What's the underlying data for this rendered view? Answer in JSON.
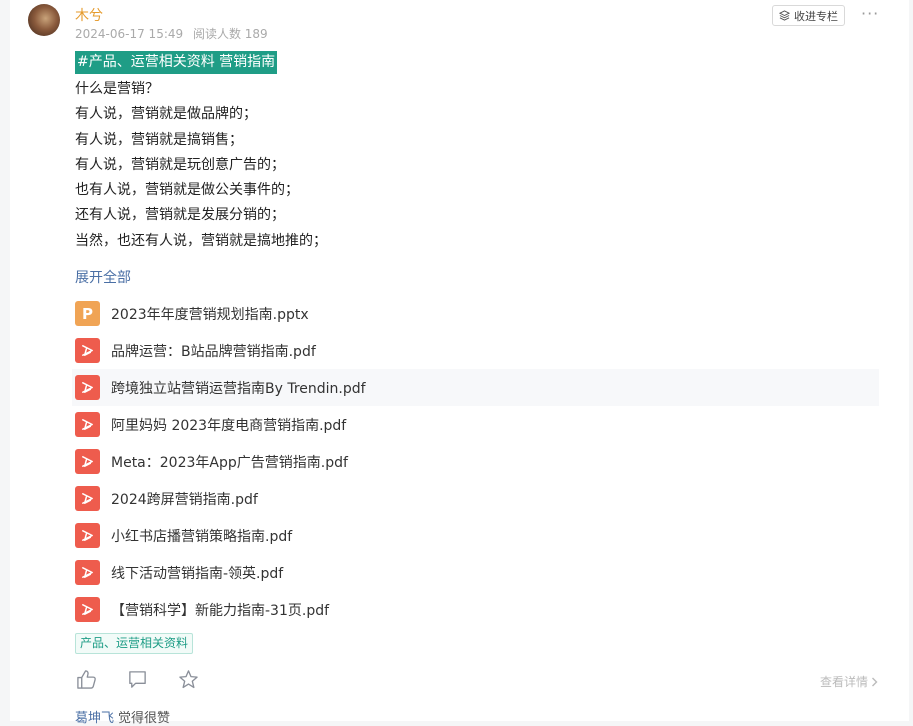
{
  "post": {
    "author": "木兮",
    "timestamp": "2024-06-17 15:49",
    "read_count": "阅读人数 189",
    "collect_label": "收进专栏",
    "more_label": "···",
    "hashtag": "#产品、运营相关资料  营销指南",
    "lines": [
      "什么是营销？",
      "有人说，营销就是做品牌的；",
      "有人说，营销就是搞销售；",
      "有人说，营销就是玩创意广告的；",
      "也有人说，营销就是做公关事件的；",
      "还有人说，营销就是发展分销的；",
      "当然，也还有人说，营销就是搞地推的；"
    ],
    "expand_label": "展开全部",
    "files": [
      {
        "name": "2023年年度营销规划指南.pptx",
        "type": "pptx",
        "icon": "ppt-file-icon"
      },
      {
        "name": "品牌运营：B站品牌营销指南.pdf",
        "type": "pdf",
        "icon": "pdf-file-icon"
      },
      {
        "name": "跨境独立站营销运营指南By Trendin.pdf",
        "type": "pdf",
        "icon": "pdf-file-icon"
      },
      {
        "name": "阿里妈妈 2023年度电商营销指南.pdf",
        "type": "pdf",
        "icon": "pdf-file-icon"
      },
      {
        "name": "Meta：2023年App广告营销指南.pdf",
        "type": "pdf",
        "icon": "pdf-file-icon"
      },
      {
        "name": "2024跨屏营销指南.pdf",
        "type": "pdf",
        "icon": "pdf-file-icon"
      },
      {
        "name": "小红书店播营销策略指南.pdf",
        "type": "pdf",
        "icon": "pdf-file-icon"
      },
      {
        "name": "线下活动营销指南-领英.pdf",
        "type": "pdf",
        "icon": "pdf-file-icon"
      },
      {
        "name": "【营销科学】新能力指南-31页.pdf",
        "type": "pdf",
        "icon": "pdf-file-icon"
      }
    ],
    "topic_tag": "产品、运营相关资料",
    "detail_label": "查看详情",
    "comment": {
      "name": "葛坤飞",
      "text": "觉得很赞"
    },
    "colors": {
      "accent": "#1f9d86",
      "author": "#e59a2b",
      "pdf": "#ee5c4d",
      "ppt": "#f0a455",
      "link": "#4a6fa5"
    }
  }
}
